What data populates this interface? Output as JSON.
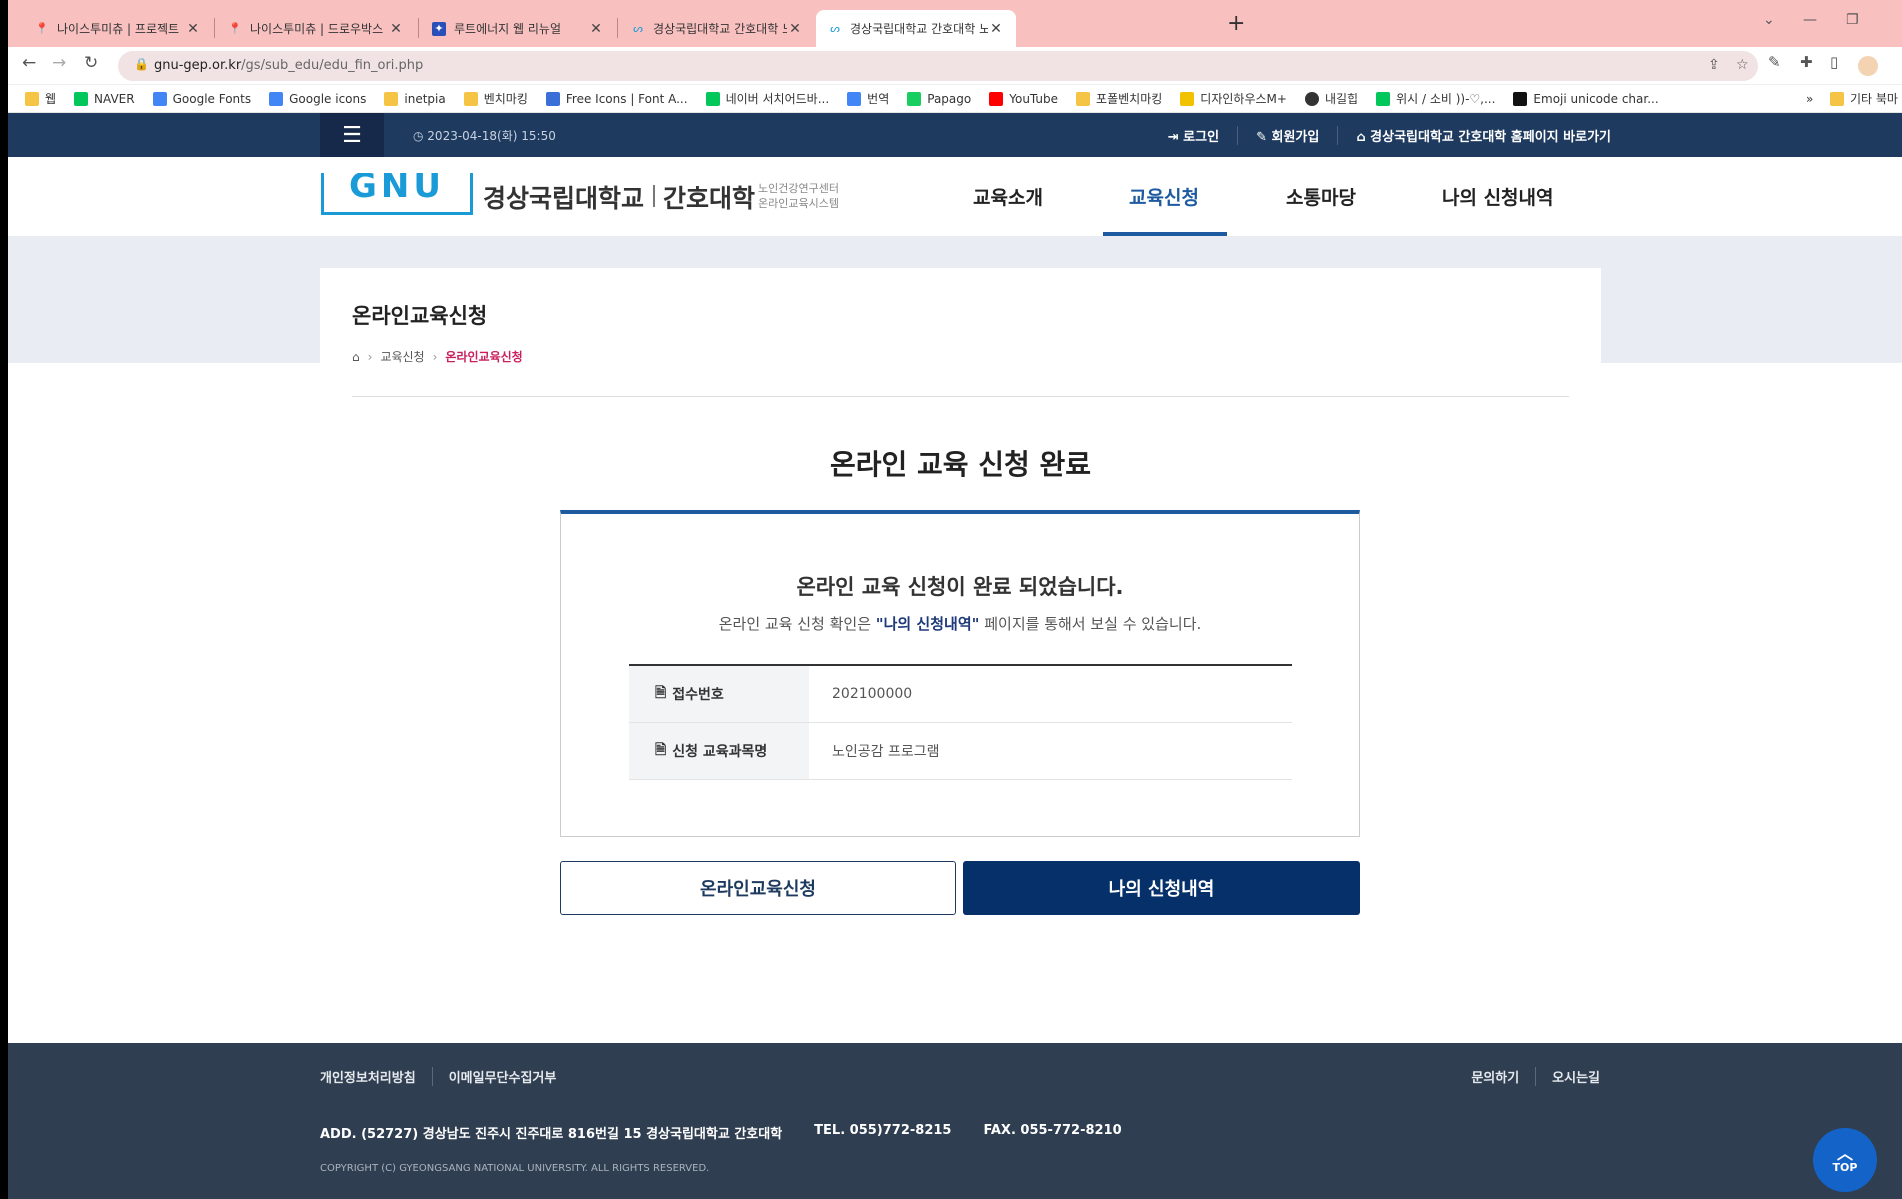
{
  "browser": {
    "tabs": [
      {
        "title": "나이스투미츄 | 프로젝트",
        "icon": "pin"
      },
      {
        "title": "나이스투미츄 | 드로우박스",
        "icon": "pin"
      },
      {
        "title": "루트에너지 웹 리뉴얼",
        "icon": "page"
      },
      {
        "title": "경상국립대학교 간호대학 노인건",
        "icon": "gnu"
      },
      {
        "title": "경상국립대학교 간호대학 노인건",
        "icon": "gnu"
      }
    ],
    "url_host": "gnu-gep.or.kr",
    "url_path": "/gs/sub_edu/edu_fin_ori.php",
    "bookmarks": [
      "웹",
      "NAVER",
      "Google Fonts",
      "Google icons",
      "inetpia",
      "벤치마킹",
      "Free Icons | Font A...",
      "네이버 서치어드바...",
      "번역",
      "Papago",
      "YouTube",
      "포폴벤치마킹",
      "디자인하우스M+",
      "내길힙",
      "위시 / 소비 ))-♡,...",
      "Emoji unicode char..."
    ],
    "bookmarks_more": "»",
    "bookmarks_other": "기타 북마"
  },
  "site": {
    "datetime": "2023-04-18(화) 15:50",
    "top_links": [
      "로그인",
      "회원가입",
      "경상국립대학교 간호대학 홈페이지 바로가기"
    ],
    "logo": {
      "mark": "GNU",
      "name1": "경상국립대학교",
      "name2": "간호대학",
      "sub1": "노인건강연구센터",
      "sub2": "온라인교육시스템"
    },
    "gnb": [
      "교육소개",
      "교육신청",
      "소통마당",
      "나의 신청내역"
    ],
    "page_title": "온라인교육신청",
    "breadcrumb": [
      "교육신청",
      "온라인교육신청"
    ],
    "done_title": "온라인 교육 신청 완료",
    "box_heading": "온라인 교육 신청이 완료 되었습니다.",
    "box_text_pre": "온라인 교육 신청 확인은 ",
    "box_text_link": "\"나의 신청내역\"",
    "box_text_post": " 페이지를 통해서 보실 수 있습니다.",
    "rows": [
      {
        "label": "접수번호",
        "value": "202100000"
      },
      {
        "label": "신청 교육과목명",
        "value": "노인공감 프로그램"
      }
    ],
    "btn_apply": "온라인교육신청",
    "btn_history": "나의 신청내역",
    "footer_links_left": [
      "개인정보처리방침",
      "이메일무단수집거부"
    ],
    "footer_links_right": [
      "문의하기",
      "오시는길"
    ],
    "address": "ADD. (52727) 경상남도 진주시 진주대로 816번길 15 경상국립대학교 간호대학",
    "tel": "TEL. 055)772-8215",
    "fax": "FAX. 055-772-8210",
    "copyright": "COPYRIGHT (C) GYEONGSANG NATIONAL UNIVERSITY. ALL RIGHTS RESERVED.",
    "top_btn": "TOP"
  },
  "colors": {
    "navy": "#1e3a5f",
    "accent": "#1e5aa0",
    "breadcrumb_current": "#c8205c",
    "footer": "#2f3e50"
  }
}
